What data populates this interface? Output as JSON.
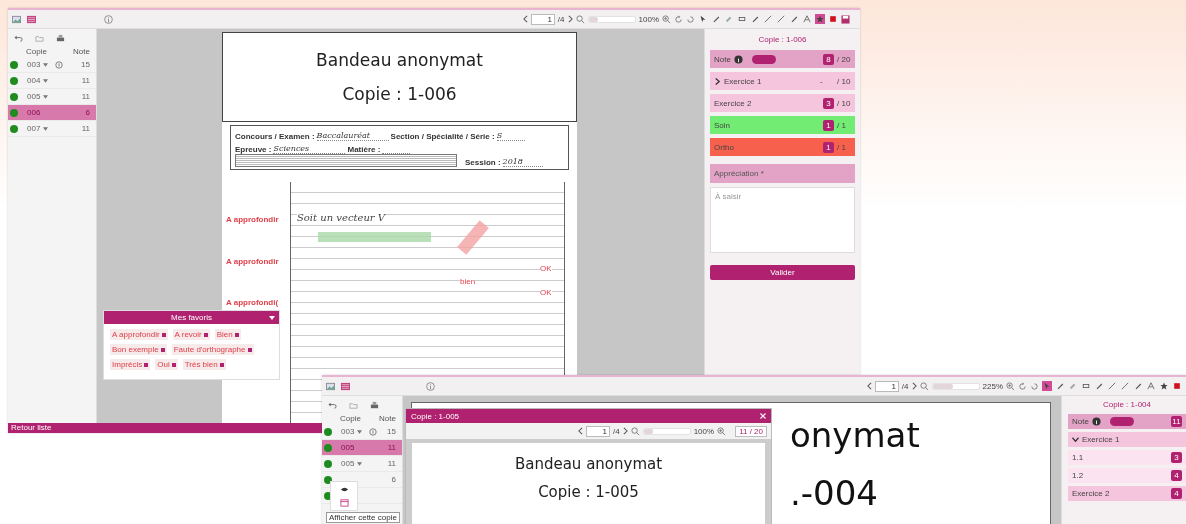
{
  "main_window": {
    "toolbar": {
      "page_input": "1",
      "page_total": "/4",
      "zoom": "100%",
      "zoom_slider": {
        "level": 0.2
      },
      "tools": [
        {
          "kind": "pointer",
          "selected": false
        },
        {
          "kind": "pen",
          "selected": false
        },
        {
          "kind": "highlighter",
          "selected": false
        },
        {
          "kind": "rect",
          "selected": false
        },
        {
          "kind": "pen",
          "selected": false
        },
        {
          "kind": "line",
          "selected": false
        },
        {
          "kind": "line",
          "selected": false
        },
        {
          "kind": "pen",
          "selected": false
        },
        {
          "kind": "text",
          "selected": false
        },
        {
          "kind": "star",
          "selected": true
        },
        {
          "kind": "color",
          "selected": false
        }
      ]
    },
    "list": {
      "columns": [
        "Copie",
        "Note"
      ],
      "rows": [
        {
          "copie": "003",
          "note": "15",
          "menu": true,
          "flag": true,
          "selected": false,
          "color": "#1e8c1e"
        },
        {
          "copie": "004",
          "note": "11",
          "menu": true,
          "flag": false,
          "selected": false,
          "color": "#1e8c1e"
        },
        {
          "copie": "005",
          "note": "11",
          "menu": true,
          "flag": false,
          "selected": false,
          "color": "#1e8c1e"
        },
        {
          "copie": "006",
          "note": "6",
          "menu": false,
          "flag": false,
          "selected": true,
          "color": "#1e8c1e"
        },
        {
          "copie": "007",
          "note": "11",
          "menu": true,
          "flag": false,
          "selected": false,
          "color": "#1e8c1e"
        }
      ]
    },
    "document": {
      "title": "Bandeau anonymat",
      "copie": "Copie :  1-006",
      "fields": [
        {
          "label": "Concours / Examen :",
          "value": "Baccalauréat"
        },
        {
          "label": "Section / Spécialité / Série :",
          "value": "S"
        },
        {
          "label": "Epreuve :",
          "value": "Sciences"
        },
        {
          "label": "Matière :"
        },
        {
          "label": "Session :",
          "value": "2018"
        }
      ],
      "handwriting": "Soit un vecteur V",
      "annotations": [
        {
          "kind": "comment",
          "text": "A approfondir"
        },
        {
          "kind": "comment",
          "text": "A approfondir"
        },
        {
          "kind": "comment",
          "text": "A approfondi("
        },
        {
          "kind": "mark",
          "text": "OK"
        },
        {
          "kind": "mark",
          "text": "bien"
        },
        {
          "kind": "mark",
          "text": "OK"
        }
      ]
    },
    "favorites": {
      "title": "Mes favoris",
      "tags": [
        "A approfondir",
        "A revoir",
        "Bien",
        "Bon exemple",
        "Faute d'orthographe",
        "Imprécis",
        "Oui",
        "Très bien"
      ]
    },
    "footer": "Retour liste",
    "grading": {
      "title": "Copie : 1-006",
      "items": [
        {
          "kind": "total",
          "label": "Note",
          "badge": "8",
          "total": "/ 20",
          "color": "#e3a3c6"
        },
        {
          "kind": "exercise",
          "label": "Exercice 1",
          "badge": "-",
          "total": "/ 10",
          "expanded": false,
          "color": "#f5c4dd"
        },
        {
          "kind": "exercise",
          "label": "Exercice 2",
          "badge": "3",
          "total": "/ 10",
          "color": "#f5c4dd"
        },
        {
          "kind": "exercise",
          "label": "Soin",
          "badge": "1",
          "total": "/ 1",
          "color": "#72ec72"
        },
        {
          "kind": "exercise",
          "label": "Ortho",
          "badge": "1",
          "total": "/ 1",
          "color": "#f8604e"
        }
      ],
      "comment_label": "Appréciation *",
      "comment_placeholder": "À saisir",
      "submit": "Valider"
    }
  },
  "front_window": {
    "toolbar": {
      "page_input": "1",
      "page_total": "/4",
      "zoom": "225%",
      "zoom_slider": {
        "level": 0.45
      },
      "tools": [
        {
          "kind": "pointer",
          "selected": true
        },
        {
          "kind": "pen",
          "selected": false
        },
        {
          "kind": "highlighter",
          "selected": false
        },
        {
          "kind": "rect",
          "selected": false
        },
        {
          "kind": "pen",
          "selected": false
        },
        {
          "kind": "line",
          "selected": false
        },
        {
          "kind": "line",
          "selected": false
        },
        {
          "kind": "pen",
          "selected": false
        },
        {
          "kind": "text",
          "selected": false
        },
        {
          "kind": "star",
          "selected": false
        },
        {
          "kind": "color",
          "selected": false
        }
      ]
    },
    "list": {
      "columns": [
        "Copie",
        "Note"
      ],
      "rows": [
        {
          "copie": "003",
          "note": "15",
          "menu": true,
          "flag": true,
          "selected": false,
          "color": "#1e8c1e"
        },
        {
          "copie": "005",
          "note": "11",
          "menu": false,
          "flag": false,
          "selected": true,
          "color": "#1e8c1e"
        },
        {
          "copie": "005",
          "note": "11",
          "menu": true,
          "flag": false,
          "selected": false,
          "color": "#1e8c1e"
        },
        {
          "note": "6",
          "menu": false,
          "flag": false,
          "selected": false,
          "color": "#1e8c1e"
        },
        {
          "menu": false,
          "flag": false,
          "selected": false,
          "color": "#1e8c1e"
        }
      ]
    },
    "row_menu_tooltip": "Afficher cette copie",
    "document": {
      "title": "onymat",
      "copie": ".-004"
    },
    "modal": {
      "title": "Copie : 1-005",
      "page_input": "1",
      "page_total": "/4",
      "zoom": "100%",
      "zoom_slider": {
        "level": 0.2
      },
      "grade": "11 / 20",
      "doc_title": "Bandeau anonymat",
      "doc_copie": "Copie :  1-005"
    },
    "grading": {
      "title": "Copie : 1-004",
      "items": [
        {
          "kind": "total",
          "label": "Note",
          "badge": "11",
          "color": "#e3a3c6"
        },
        {
          "kind": "exercise",
          "label": "Exercice 1",
          "expanded": true,
          "color": "#f5c4dd"
        },
        {
          "kind": "sub",
          "label": "1.1",
          "badge": "3",
          "color": "#fbe3ef"
        },
        {
          "kind": "sub",
          "label": "1.2",
          "badge": "4",
          "color": "#fbe3ef"
        },
        {
          "kind": "exercise",
          "label": "Exercice 2",
          "badge": "4",
          "color": "#f5c4dd"
        }
      ]
    }
  }
}
